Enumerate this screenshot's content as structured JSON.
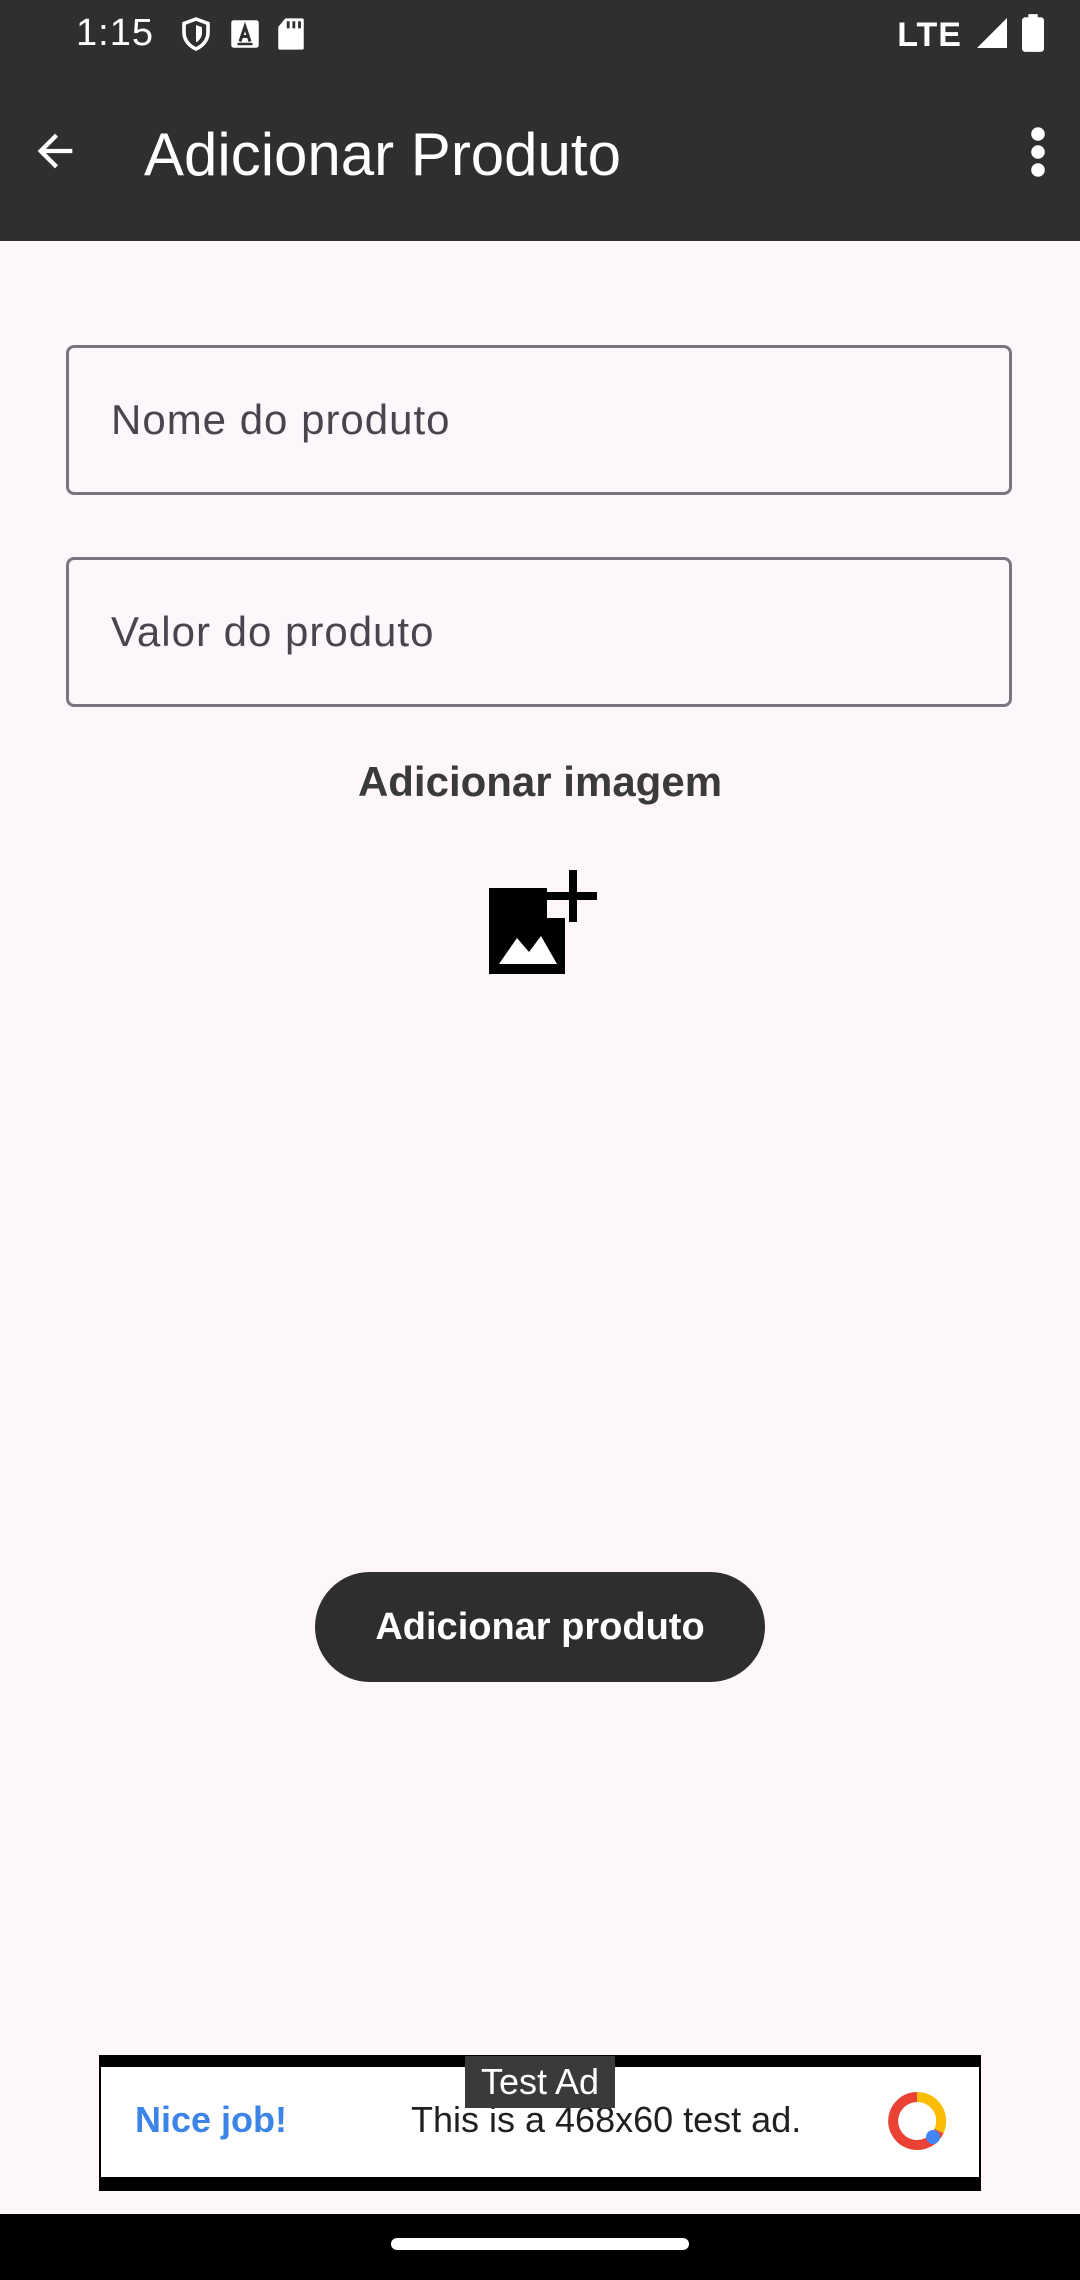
{
  "status_bar": {
    "time": "1:15",
    "network": "LTE",
    "icons_left": [
      "shield-icon",
      "a-notification-icon",
      "sd-card-icon"
    ],
    "icons_right": [
      "signal-icon",
      "battery-icon"
    ]
  },
  "app_bar": {
    "title": "Adicionar Produto",
    "back_icon": "arrow-back-icon",
    "menu_icon": "more-vert-icon"
  },
  "form": {
    "name_placeholder": "Nome do produto",
    "value_placeholder": "Valor do produto",
    "add_image_label": "Adicionar imagem",
    "add_image_icon": "add-photo-icon",
    "submit_label": "Adicionar produto"
  },
  "ad": {
    "label": "Test Ad",
    "cta": "Nice job!",
    "text": "This is a 468x60 test ad."
  },
  "colors": {
    "app_bar": "#2F2F2F",
    "background": "#FDF7FC",
    "button": "#2E2E2E",
    "outline": "#7A757F",
    "ad_link": "#3C84E6"
  }
}
